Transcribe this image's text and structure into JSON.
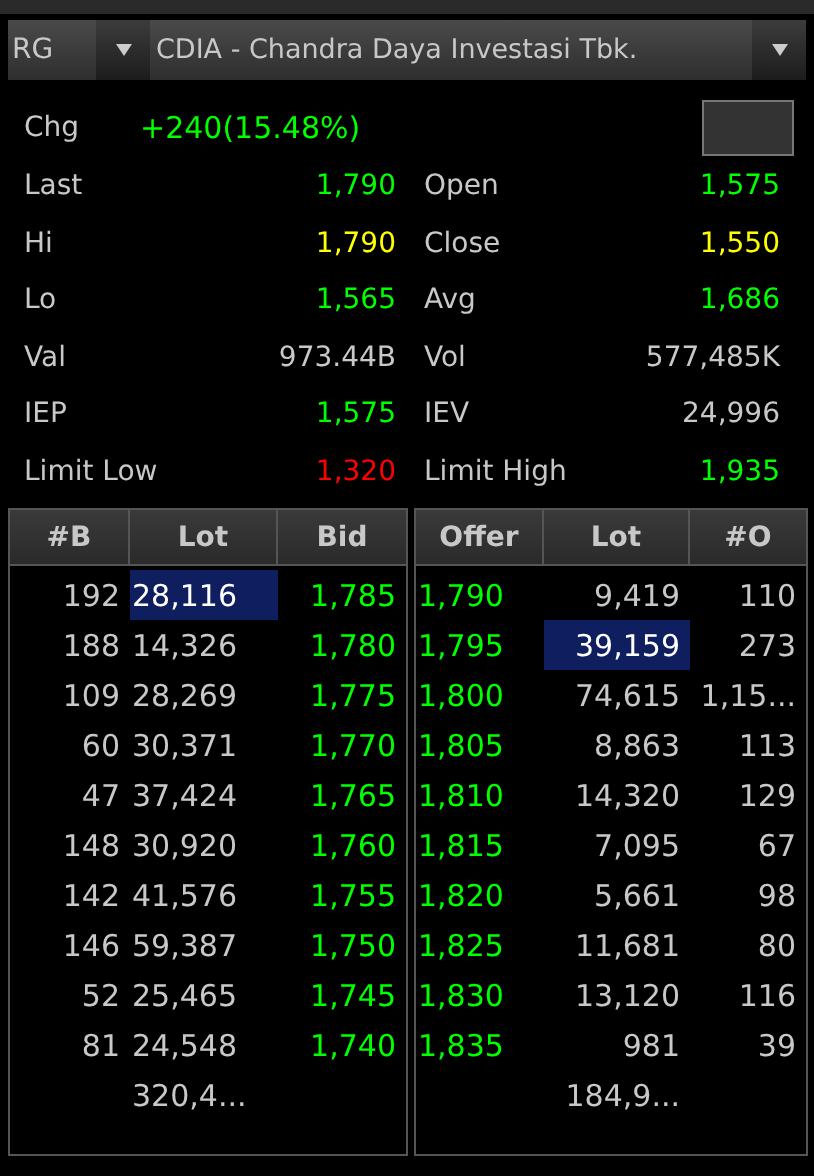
{
  "header": {
    "board": "RG",
    "stock": "CDIA - Chandra Daya Investasi Tbk."
  },
  "change": {
    "label": "Chg",
    "value": "+240(15.48%)",
    "color": "#00ff00"
  },
  "stats": [
    {
      "label": "Last",
      "value": "1,790",
      "color": "#00ff00"
    },
    {
      "label": "Open",
      "value": "1,575",
      "color": "#00ff00"
    },
    {
      "label": "Hi",
      "value": "1,790",
      "color": "#ffff00"
    },
    {
      "label": "Close",
      "value": "1,550",
      "color": "#ffff00"
    },
    {
      "label": "Lo",
      "value": "1,565",
      "color": "#00ff00"
    },
    {
      "label": "Avg",
      "value": "1,686",
      "color": "#00ff00"
    },
    {
      "label": "Val",
      "value": "973.44B",
      "color": "#c8c8c8"
    },
    {
      "label": "Vol",
      "value": "577,485K",
      "color": "#c8c8c8"
    },
    {
      "label": "IEP",
      "value": "1,575",
      "color": "#00ff00"
    },
    {
      "label": "IEV",
      "value": "24,996",
      "color": "#c8c8c8"
    },
    {
      "label": "Limit Low",
      "value": "1,320",
      "color": "#ff0000"
    },
    {
      "label": "Limit High",
      "value": "1,935",
      "color": "#00ff00"
    }
  ],
  "bids": {
    "columns": [
      "#B",
      "Lot",
      "Bid"
    ],
    "rows": [
      {
        "count": "192",
        "lot": "28,116",
        "price": "1,785",
        "highlighted": true
      },
      {
        "count": "188",
        "lot": "14,326",
        "price": "1,780",
        "highlighted": false
      },
      {
        "count": "109",
        "lot": "28,269",
        "price": "1,775",
        "highlighted": false
      },
      {
        "count": "60",
        "lot": "30,371",
        "price": "1,770",
        "highlighted": false
      },
      {
        "count": "47",
        "lot": "37,424",
        "price": "1,765",
        "highlighted": false
      },
      {
        "count": "148",
        "lot": "30,920",
        "price": "1,760",
        "highlighted": false
      },
      {
        "count": "142",
        "lot": "41,576",
        "price": "1,755",
        "highlighted": false
      },
      {
        "count": "146",
        "lot": "59,387",
        "price": "1,750",
        "highlighted": false
      },
      {
        "count": "52",
        "lot": "25,465",
        "price": "1,745",
        "highlighted": false
      },
      {
        "count": "81",
        "lot": "24,548",
        "price": "1,740",
        "highlighted": false
      }
    ],
    "total_lot": "320,4..."
  },
  "offers": {
    "columns": [
      "Offer",
      "Lot",
      "#O"
    ],
    "rows": [
      {
        "price": "1,790",
        "lot": "9,419",
        "count": "110",
        "highlighted": false
      },
      {
        "price": "1,795",
        "lot": "39,159",
        "count": "273",
        "highlighted": true
      },
      {
        "price": "1,800",
        "lot": "74,615",
        "count": "1,15...",
        "highlighted": false
      },
      {
        "price": "1,805",
        "lot": "8,863",
        "count": "113",
        "highlighted": false
      },
      {
        "price": "1,810",
        "lot": "14,320",
        "count": "129",
        "highlighted": false
      },
      {
        "price": "1,815",
        "lot": "7,095",
        "count": "67",
        "highlighted": false
      },
      {
        "price": "1,820",
        "lot": "5,661",
        "count": "98",
        "highlighted": false
      },
      {
        "price": "1,825",
        "lot": "11,681",
        "count": "80",
        "highlighted": false
      },
      {
        "price": "1,830",
        "lot": "13,120",
        "count": "116",
        "highlighted": false
      },
      {
        "price": "1,835",
        "lot": "981",
        "count": "39",
        "highlighted": false
      }
    ],
    "total_lot": "184,9..."
  }
}
